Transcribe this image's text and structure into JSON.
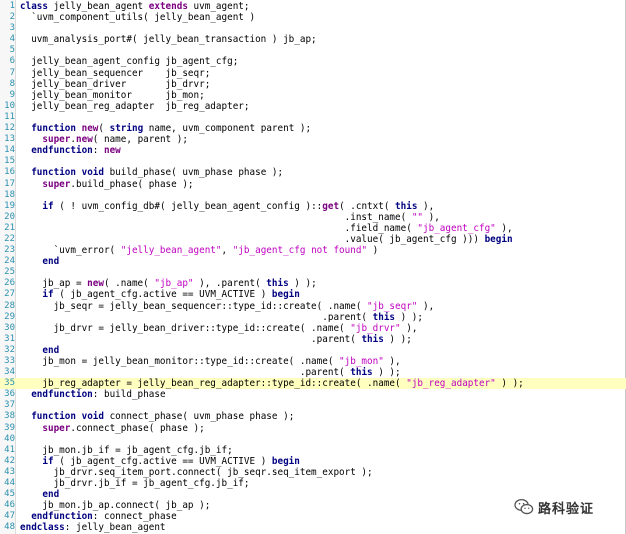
{
  "editor": {
    "highlighted_line": 35,
    "lines": [
      {
        "n": "1",
        "segs": [
          [
            "kw",
            "class"
          ],
          [
            "t",
            " jelly_bean_agent "
          ],
          [
            "kp",
            "extends"
          ],
          [
            "t",
            " uvm_agent;"
          ]
        ]
      },
      {
        "n": "2",
        "segs": [
          [
            "t",
            "  `uvm_component_utils( jelly_bean_agent )"
          ]
        ]
      },
      {
        "n": "3",
        "segs": []
      },
      {
        "n": "4",
        "segs": [
          [
            "t",
            "  uvm_analysis_port#( jelly_bean_transaction ) jb_ap;"
          ]
        ]
      },
      {
        "n": "5",
        "segs": []
      },
      {
        "n": "6",
        "segs": [
          [
            "t",
            "  jelly_bean_agent_config jb_agent_cfg;"
          ]
        ]
      },
      {
        "n": "7",
        "segs": [
          [
            "t",
            "  jelly_bean_sequencer    jb_seqr;"
          ]
        ]
      },
      {
        "n": "8",
        "segs": [
          [
            "t",
            "  jelly_bean_driver       jb_drvr;"
          ]
        ]
      },
      {
        "n": "9",
        "segs": [
          [
            "t",
            "  jelly_bean_monitor      jb_mon;"
          ]
        ]
      },
      {
        "n": "10",
        "segs": [
          [
            "t",
            "  jelly_bean_reg_adapter  jb_reg_adapter;"
          ]
        ]
      },
      {
        "n": "11",
        "segs": []
      },
      {
        "n": "12",
        "segs": [
          [
            "t",
            "  "
          ],
          [
            "kw",
            "function"
          ],
          [
            "t",
            " "
          ],
          [
            "kp",
            "new"
          ],
          [
            "t",
            "( "
          ],
          [
            "kw",
            "string"
          ],
          [
            "t",
            " name, uvm_component parent );"
          ]
        ]
      },
      {
        "n": "13",
        "segs": [
          [
            "t",
            "    "
          ],
          [
            "kp",
            "super"
          ],
          [
            "t",
            "."
          ],
          [
            "kp",
            "new"
          ],
          [
            "t",
            "( name, parent );"
          ]
        ]
      },
      {
        "n": "14",
        "segs": [
          [
            "t",
            "  "
          ],
          [
            "kw",
            "endfunction"
          ],
          [
            "t",
            ": "
          ],
          [
            "kp",
            "new"
          ]
        ]
      },
      {
        "n": "15",
        "segs": []
      },
      {
        "n": "16",
        "segs": [
          [
            "t",
            "  "
          ],
          [
            "kw",
            "function"
          ],
          [
            "t",
            " "
          ],
          [
            "kw",
            "void"
          ],
          [
            "t",
            " build_phase( uvm_phase phase );"
          ]
        ]
      },
      {
        "n": "17",
        "segs": [
          [
            "t",
            "    "
          ],
          [
            "kp",
            "super"
          ],
          [
            "t",
            ".build_phase( phase );"
          ]
        ]
      },
      {
        "n": "18",
        "segs": []
      },
      {
        "n": "19",
        "segs": [
          [
            "t",
            "    "
          ],
          [
            "kw",
            "if"
          ],
          [
            "t",
            " ( ! uvm_config_db#( jelly_bean_agent_config )::"
          ],
          [
            "kp",
            "get"
          ],
          [
            "t",
            "( .cntxt( "
          ],
          [
            "kw",
            "this"
          ],
          [
            "t",
            " ),"
          ]
        ]
      },
      {
        "n": "20",
        "segs": [
          [
            "t",
            "                                                          .inst_name( "
          ],
          [
            "str",
            "\"\""
          ],
          [
            "t",
            " ),"
          ]
        ]
      },
      {
        "n": "21",
        "segs": [
          [
            "t",
            "                                                          .field_name( "
          ],
          [
            "str",
            "\"jb_agent_cfg\""
          ],
          [
            "t",
            " ),"
          ]
        ]
      },
      {
        "n": "22",
        "segs": [
          [
            "t",
            "                                                          .value( jb_agent_cfg ))) "
          ],
          [
            "kw",
            "begin"
          ]
        ]
      },
      {
        "n": "23",
        "segs": [
          [
            "t",
            "      `uvm_error( "
          ],
          [
            "str",
            "\"jelly_bean_agent\""
          ],
          [
            "t",
            ", "
          ],
          [
            "str",
            "\"jb_agent_cfg not found\""
          ],
          [
            "t",
            " )"
          ]
        ]
      },
      {
        "n": "24",
        "segs": [
          [
            "t",
            "    "
          ],
          [
            "kw",
            "end"
          ]
        ]
      },
      {
        "n": "25",
        "segs": []
      },
      {
        "n": "26",
        "segs": [
          [
            "t",
            "    jb_ap = "
          ],
          [
            "kp",
            "new"
          ],
          [
            "t",
            "( .name( "
          ],
          [
            "str",
            "\"jb_ap\""
          ],
          [
            "t",
            " ), .parent( "
          ],
          [
            "kw",
            "this"
          ],
          [
            "t",
            " ) );"
          ]
        ]
      },
      {
        "n": "27",
        "segs": [
          [
            "t",
            "    "
          ],
          [
            "kw",
            "if"
          ],
          [
            "t",
            " ( jb_agent_cfg.active == UVM_ACTIVE ) "
          ],
          [
            "kw",
            "begin"
          ]
        ]
      },
      {
        "n": "28",
        "segs": [
          [
            "t",
            "      jb_seqr = jelly_bean_sequencer::type_id::create( .name( "
          ],
          [
            "str",
            "\"jb_seqr\""
          ],
          [
            "t",
            " ),"
          ]
        ]
      },
      {
        "n": "29",
        "segs": [
          [
            "t",
            "                                                      .parent( "
          ],
          [
            "kw",
            "this"
          ],
          [
            "t",
            " ) );"
          ]
        ]
      },
      {
        "n": "30",
        "segs": [
          [
            "t",
            "      jb_drvr = jelly_bean_driver::type_id::create( .name( "
          ],
          [
            "str",
            "\"jb_drvr\""
          ],
          [
            "t",
            " ),"
          ]
        ]
      },
      {
        "n": "31",
        "segs": [
          [
            "t",
            "                                                    .parent( "
          ],
          [
            "kw",
            "this"
          ],
          [
            "t",
            " ) );"
          ]
        ]
      },
      {
        "n": "32",
        "segs": [
          [
            "t",
            "    "
          ],
          [
            "kw",
            "end"
          ]
        ]
      },
      {
        "n": "33",
        "segs": [
          [
            "t",
            "    jb_mon = jelly_bean_monitor::type_id::create( .name( "
          ],
          [
            "str",
            "\"jb_mon\""
          ],
          [
            "t",
            " ),"
          ]
        ]
      },
      {
        "n": "34",
        "segs": [
          [
            "t",
            "                                                  .parent( "
          ],
          [
            "kw",
            "this"
          ],
          [
            "t",
            " ) );"
          ]
        ]
      },
      {
        "n": "35",
        "segs": [
          [
            "t",
            "    jb_reg_adapter = jelly_bean_reg_adapter::type_id::create( .name( "
          ],
          [
            "str",
            "\"jb_reg_adapter\""
          ],
          [
            "t",
            " ) );"
          ]
        ]
      },
      {
        "n": "36",
        "segs": [
          [
            "t",
            "  "
          ],
          [
            "kw",
            "endfunction"
          ],
          [
            "t",
            ": build_phase"
          ]
        ]
      },
      {
        "n": "37",
        "segs": []
      },
      {
        "n": "38",
        "segs": [
          [
            "t",
            "  "
          ],
          [
            "kw",
            "function"
          ],
          [
            "t",
            " "
          ],
          [
            "kw",
            "void"
          ],
          [
            "t",
            " connect_phase( uvm_phase phase );"
          ]
        ]
      },
      {
        "n": "39",
        "segs": [
          [
            "t",
            "    "
          ],
          [
            "kp",
            "super"
          ],
          [
            "t",
            ".connect_phase( phase );"
          ]
        ]
      },
      {
        "n": "40",
        "segs": []
      },
      {
        "n": "41",
        "segs": [
          [
            "t",
            "    jb_mon.jb_if = jb_agent_cfg.jb_if;"
          ]
        ]
      },
      {
        "n": "42",
        "segs": [
          [
            "t",
            "    "
          ],
          [
            "kw",
            "if"
          ],
          [
            "t",
            " ( jb_agent_cfg.active == UVM_ACTIVE ) "
          ],
          [
            "kw",
            "begin"
          ]
        ]
      },
      {
        "n": "43",
        "segs": [
          [
            "t",
            "      jb_drvr.seq_item_port.connect( jb_seqr.seq_item_export );"
          ]
        ]
      },
      {
        "n": "44",
        "segs": [
          [
            "t",
            "      jb_drvr.jb_if = jb_agent_cfg.jb_if;"
          ]
        ]
      },
      {
        "n": "45",
        "segs": [
          [
            "t",
            "    "
          ],
          [
            "kw",
            "end"
          ]
        ]
      },
      {
        "n": "46",
        "segs": [
          [
            "t",
            "    jb_mon.jb_ap.connect( jb_ap );"
          ]
        ]
      },
      {
        "n": "47",
        "segs": [
          [
            "t",
            "  "
          ],
          [
            "kw",
            "endfunction"
          ],
          [
            "t",
            ": connect_phase"
          ]
        ]
      },
      {
        "n": "48",
        "segs": [
          [
            "kw",
            "endclass"
          ],
          [
            "t",
            ": jelly_bean_agent"
          ]
        ]
      }
    ]
  },
  "watermark": {
    "text": "路科验证",
    "icon": "wechat-icon"
  },
  "colors": {
    "keyword": "#000080",
    "special": "#7a0080",
    "string": "#c000c0",
    "line_number": "#2b91af",
    "highlight": "#ffffc0"
  }
}
